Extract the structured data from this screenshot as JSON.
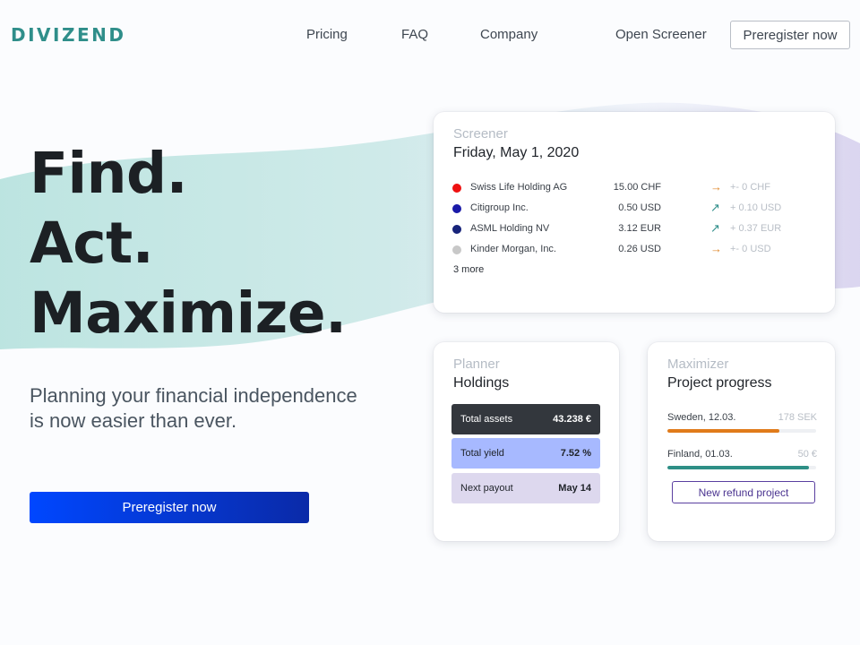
{
  "brand": {
    "logo": "DIVIZEND"
  },
  "nav": {
    "links": [
      "Pricing",
      "FAQ",
      "Company",
      "Open Screener"
    ],
    "cta": "Preregister now"
  },
  "hero": {
    "title_lines": [
      "Find.",
      "Act.",
      "Maximize."
    ],
    "subtitle_lines": [
      "Planning your financial independence",
      "is now easier than ever."
    ],
    "cta": "Preregister now"
  },
  "screener": {
    "eyebrow": "Screener",
    "date": "Friday, May 1, 2020",
    "rows": [
      {
        "name": "Swiss Life Holding AG",
        "value": "15.00 CHF",
        "arrow": "→",
        "arrow_color": "#e08a2c",
        "change": "+- 0 CHF",
        "dot_color": "#ee1111"
      },
      {
        "name": "Citigroup Inc.",
        "value": "0.50 USD",
        "arrow": "↗",
        "arrow_color": "#2f8e8a",
        "change": "+ 0.10 USD",
        "dot_color": "#1a1aa8"
      },
      {
        "name": "ASML Holding NV",
        "value": "3.12 EUR",
        "arrow": "↗",
        "arrow_color": "#2f8e8a",
        "change": "+ 0.37 EUR",
        "dot_color": "#17237a"
      },
      {
        "name": "Kinder Morgan, Inc.",
        "value": "0.26 USD",
        "arrow": "→",
        "arrow_color": "#e08a2c",
        "change": "+- 0 USD",
        "dot_color": "#c8c8c8"
      }
    ],
    "more": "3 more"
  },
  "planner": {
    "eyebrow": "Planner",
    "heading": "Holdings",
    "items": [
      {
        "label": "Total assets",
        "value": "43.238 €",
        "bg": "#33373d",
        "fg": "#ffffff"
      },
      {
        "label": "Total yield",
        "value": "7.52 %",
        "bg": "#a7b9ff",
        "fg": "#1f2329"
      },
      {
        "label": "Next payout",
        "value": "May 14",
        "bg": "#ddd8ee",
        "fg": "#1f2329"
      }
    ]
  },
  "maximizer": {
    "eyebrow": "Maximizer",
    "heading": "Project progress",
    "projects": [
      {
        "label": "Sweden, 12.03.",
        "value": "178 SEK",
        "progress": 0.75,
        "color": "#e07b1a"
      },
      {
        "label": "Finland, 01.03.",
        "value": "50 €",
        "progress": 0.95,
        "color": "#2e8f86"
      }
    ],
    "button": "New refund project"
  }
}
